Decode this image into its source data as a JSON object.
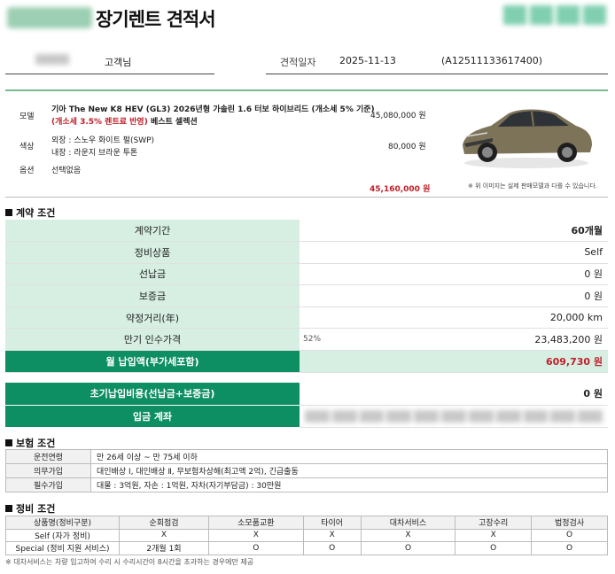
{
  "header": {
    "title": "장기렌트 견적서",
    "customer_suffix": "고객님",
    "quote_date_label": "견적일자",
    "quote_date": "2025-11-13",
    "quote_id": "(A12511133617400)"
  },
  "vehicle": {
    "model_label": "모델",
    "model_line1": "기아 The New K8 HEV (GL3) 2026년형 가솔린 1.6 터보 하이브리드 (개소세 5% 기준)",
    "model_line2_red": "(개소세 3.5% 렌트료 반영)",
    "model_line2_rest": " 베스트 셀렉션",
    "model_price": "45,080,000 원",
    "color_label": "색상",
    "exterior": "외장 : 스노우 화이트 펄(SWP)",
    "interior": "내장 : 라운지 브라운 투톤",
    "color_price": "80,000 원",
    "option_label": "옵션",
    "option_value": "선택없음",
    "total_price": "45,160,000 원",
    "image_note": "※ 위 이미지는 실제 판매모델과 다를 수 있습니다."
  },
  "contract": {
    "section_title": "계약 조건",
    "rows": [
      {
        "label": "계약기간",
        "value": "60개월",
        "note": ""
      },
      {
        "label": "정비상품",
        "value": "Self",
        "note": ""
      },
      {
        "label": "선납금",
        "value": "0 원",
        "note": ""
      },
      {
        "label": "보증금",
        "value": "0 원",
        "note": ""
      },
      {
        "label": "약정거리(年)",
        "value": "20,000 km",
        "note": ""
      },
      {
        "label": "만기 인수가격",
        "value": "23,483,200 원",
        "note": "52%"
      }
    ],
    "monthly_label": "월 납입액(부가세포함)",
    "monthly_value": "609,730 원",
    "initial_label": "초기납입비용(선납금+보증금)",
    "initial_value": "0 원",
    "account_label": "입금 계좌"
  },
  "insurance": {
    "section_title": "보험 조건",
    "rows": [
      {
        "label": "운전연령",
        "value": "만 26세 이상 ~ 만 75세 이하"
      },
      {
        "label": "의무가입",
        "value": "대인배상 Ⅰ, 대인배상 Ⅱ, 무보험차상해(최고액 2억), 긴급출동"
      },
      {
        "label": "필수가입",
        "value": "대물 : 3억원, 자손 : 1억원, 자차(자기부담금) : 30만원"
      }
    ]
  },
  "maintenance": {
    "section_title": "정비 조건",
    "headers": [
      "상품명(정비구분)",
      "순회점검",
      "소모품교환",
      "타이어",
      "대차서비스",
      "고장수리",
      "법정검사"
    ],
    "rows": [
      [
        "Self (자가 정비)",
        "X",
        "X",
        "X",
        "X",
        "X",
        "O"
      ],
      [
        "Special (정비 지원 서비스)",
        "2개월 1회",
        "O",
        "O",
        "O",
        "O",
        "O"
      ]
    ],
    "footnote": "※ 대차서비스는 차량 입고하여 수리 시 수리시간이 8시간을 초과하는 경우에만 제공"
  }
}
